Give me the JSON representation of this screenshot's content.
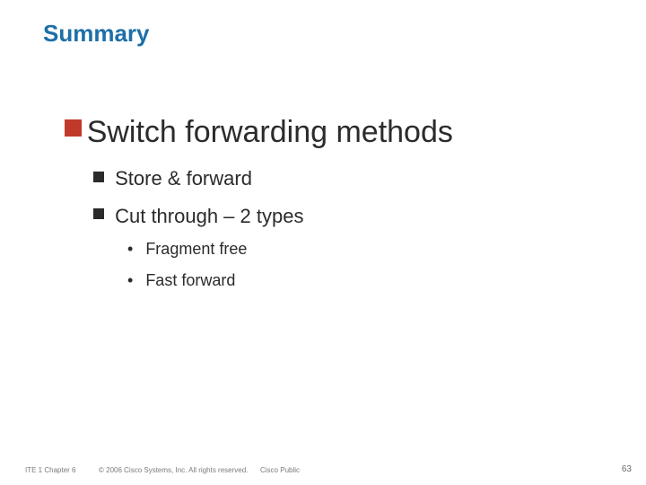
{
  "title": "Summary",
  "body": {
    "heading": "Switch forwarding methods",
    "items": [
      {
        "text": "Store & forward"
      },
      {
        "text": "Cut through – 2 types",
        "sub": [
          {
            "text": "Fragment free"
          },
          {
            "text": "Fast forward"
          }
        ]
      }
    ]
  },
  "footer": {
    "left": "ITE 1 Chapter 6",
    "copyright": "© 2006 Cisco Systems, Inc. All rights reserved.",
    "tag": "Cisco Public",
    "page": "63"
  }
}
